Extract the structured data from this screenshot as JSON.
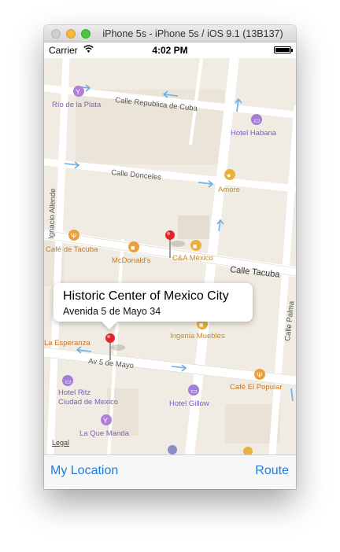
{
  "window": {
    "title": "iPhone 5s - iPhone 5s / iOS 9.1 (13B137)"
  },
  "status_bar": {
    "carrier": "Carrier",
    "time": "4:02 PM"
  },
  "map": {
    "streets": {
      "republica_cuba": "Calle Republica de Cuba",
      "donceles": "Calle Donceles",
      "tacuba": "Calle Tacuba",
      "cinco_de_mayo": "Av 5 de Mayo",
      "palma": "Calle Palma",
      "allende": "Ignacio Allende"
    },
    "pois": {
      "rio_de_la_plata": "Río de la Plata",
      "hotel_habana": "Hotel Habana",
      "amore": "Amore",
      "cafe_de_tacuba": "Café de Tacuba",
      "mcdonalds": "McDonald's",
      "ca_mexico": "C&A México",
      "la_esperanza": "La Esperanza",
      "ingenia_muebles": "Ingenia Muebles",
      "cafe_el_popular": "Café El Popular",
      "hotel_ritz_line1": "Hotel Ritz",
      "hotel_ritz_line2": "Ciudad de Mexico",
      "hotel_gillow": "Hotel Gillow",
      "la_que_manda": "La Que Manda"
    },
    "callout": {
      "title": "Historic Center of Mexico City",
      "subtitle": "Avenida 5 de Mayo 34"
    },
    "legal": "Legal"
  },
  "toolbar": {
    "left_label": "My Location",
    "right_label": "Route"
  },
  "colors": {
    "accent": "#1a7fe0",
    "food_orange": "#e9a03c",
    "hotel_purple": "#a27ed6",
    "pin_red": "#e4262c",
    "one_way_arrow": "#6aaee8"
  }
}
